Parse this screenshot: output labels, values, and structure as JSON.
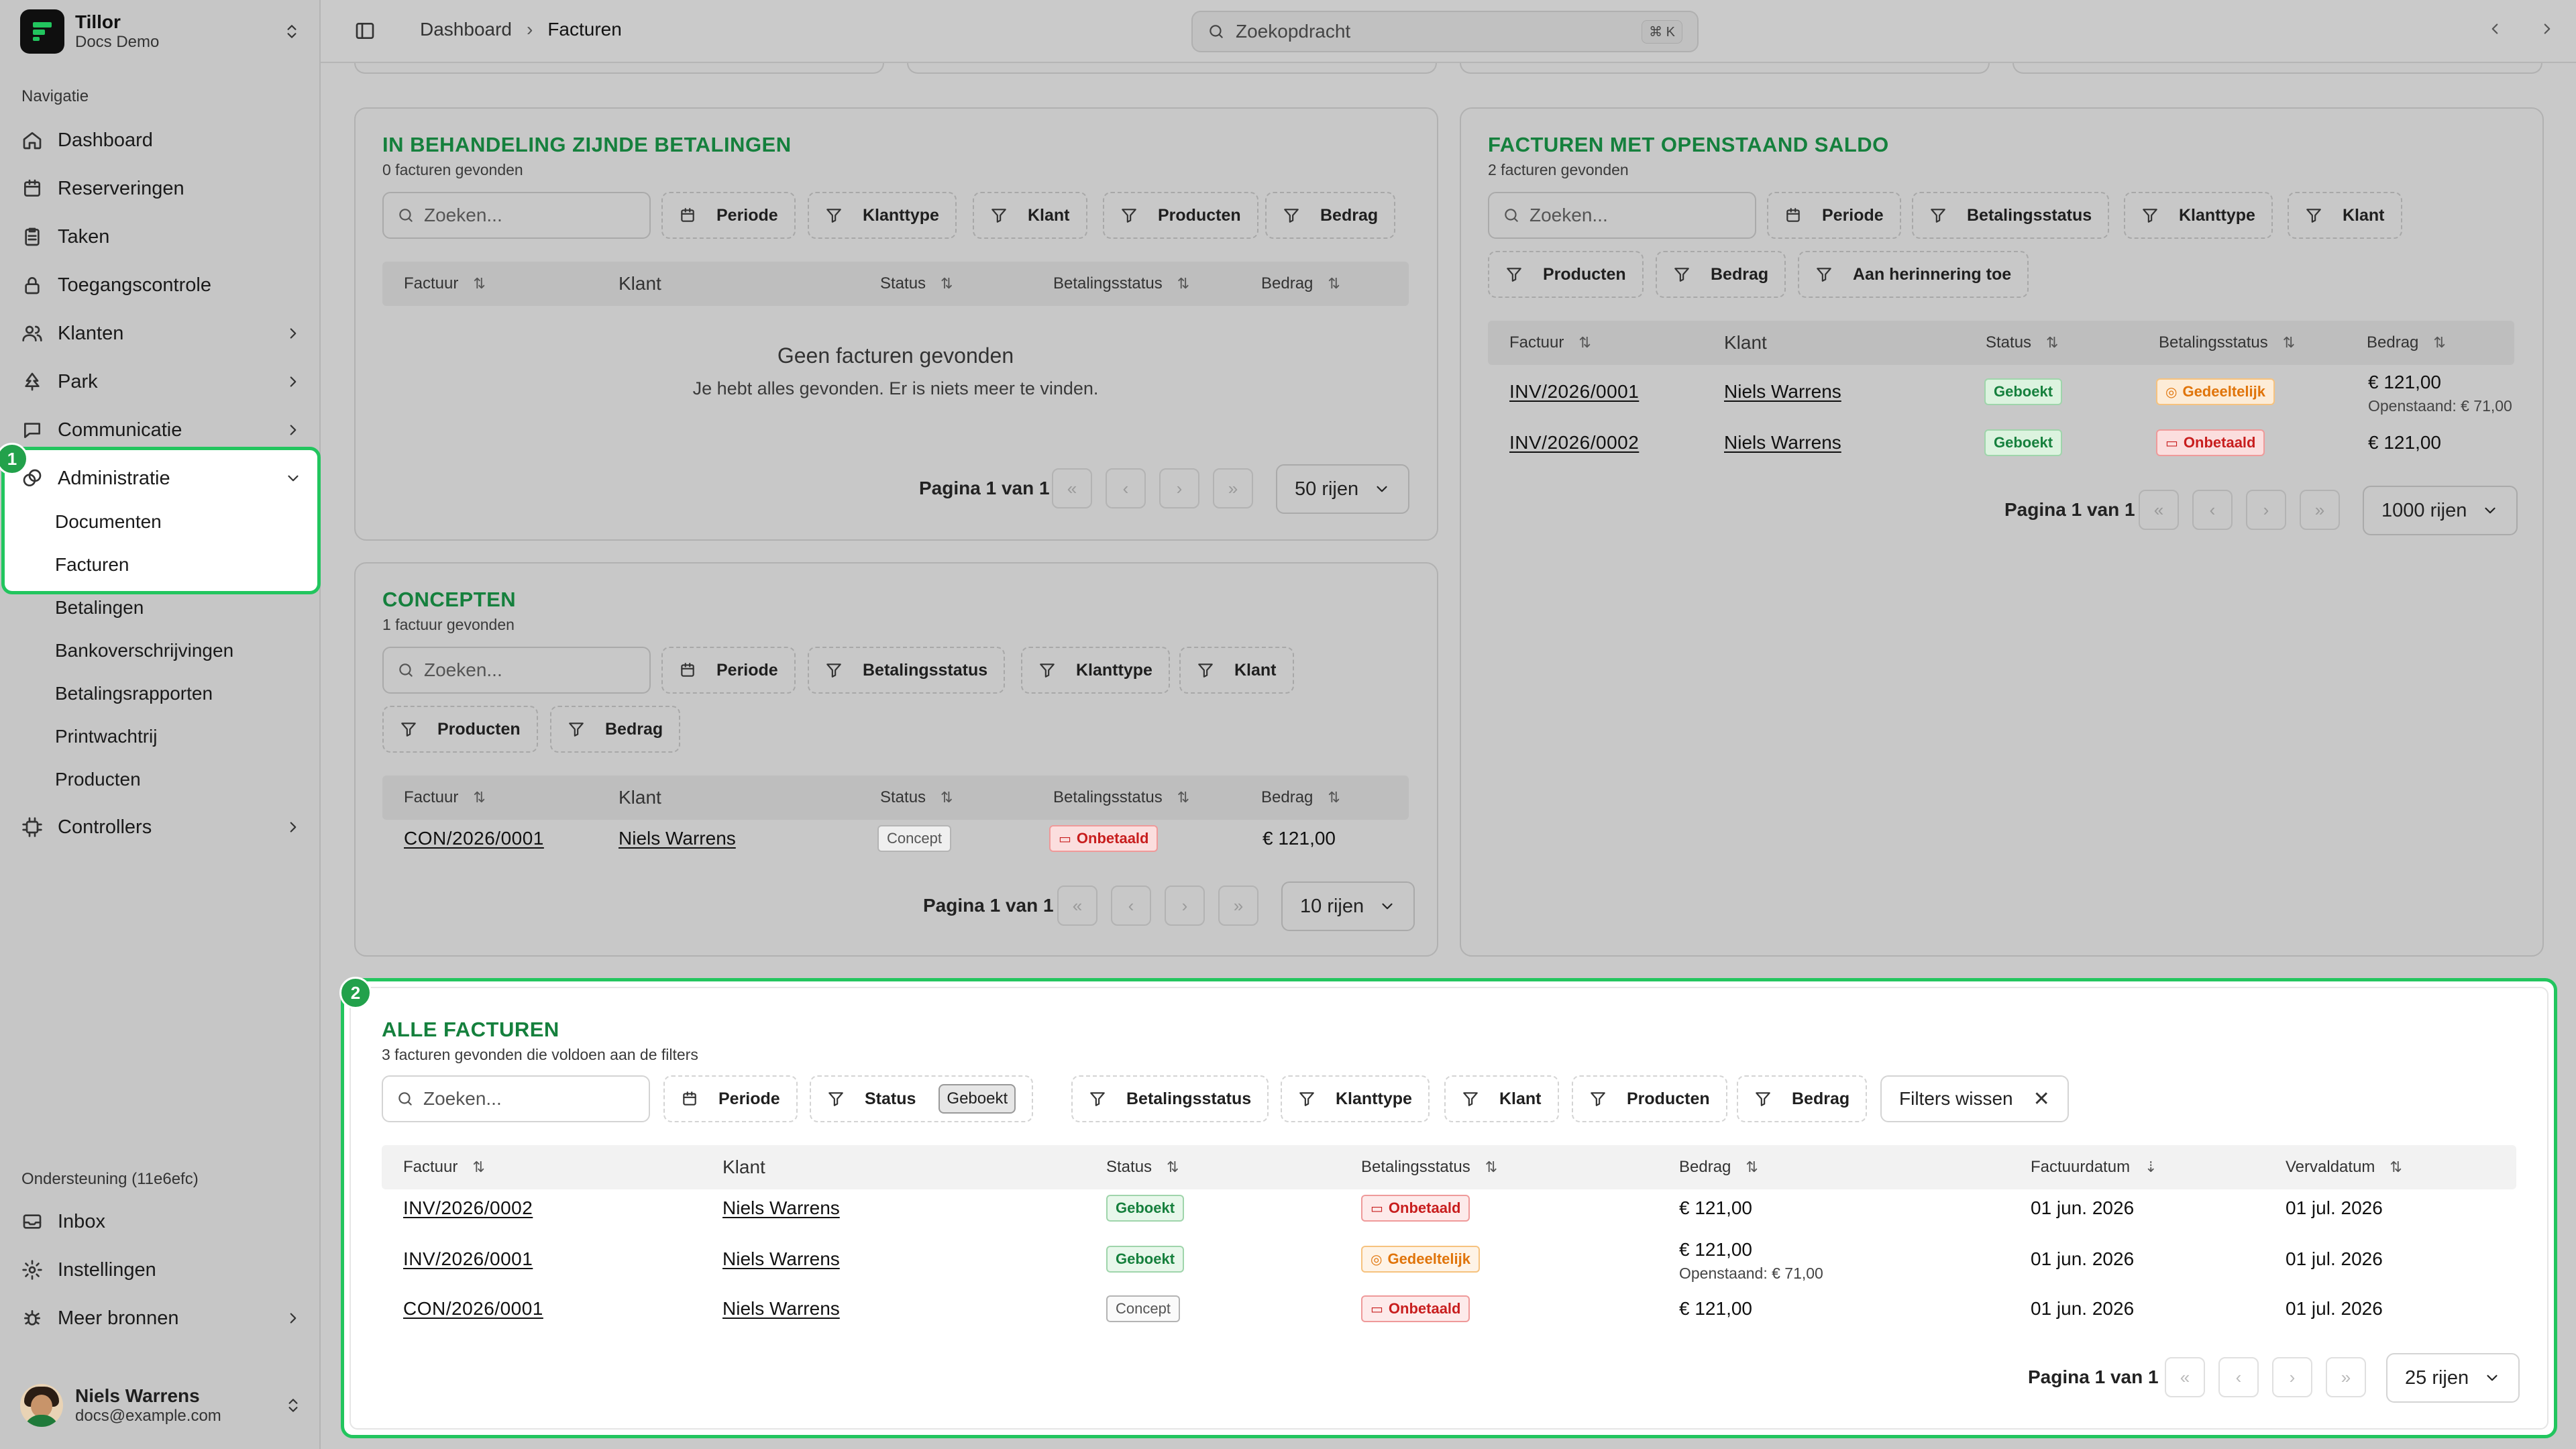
{
  "workspace": {
    "name": "Tillor",
    "sub": "Docs Demo"
  },
  "nav": {
    "section": "Navigatie",
    "items": [
      "Dashboard",
      "Reserveringen",
      "Taken",
      "Toegangscontrole",
      "Klanten",
      "Park",
      "Communicatie",
      "Administratie"
    ],
    "admin_sub": [
      "Documenten",
      "Facturen",
      "Betalingen",
      "Bankoverschrijvingen",
      "Betalingsrapporten",
      "Printwachtrij",
      "Producten"
    ],
    "controllers": "Controllers",
    "support_section": "Ondersteuning (11e6efc)",
    "support": [
      "Inbox",
      "Instellingen",
      "Meer bronnen"
    ]
  },
  "user": {
    "name": "Niels Warrens",
    "email": "docs@example.com"
  },
  "header": {
    "crumb1": "Dashboard",
    "crumb2": "Facturen",
    "search_placeholder": "Zoekopdracht",
    "shortcut": "⌘ K"
  },
  "badges": [
    "1",
    "2"
  ],
  "common": {
    "search": "Zoeken...",
    "page": "Pagina 1 van 1",
    "col_factuur": "Factuur",
    "col_klant": "Klant",
    "col_status": "Status",
    "col_betaal": "Betalingsstatus",
    "col_bedrag": "Bedrag",
    "col_fdatum": "Factuurdatum",
    "col_vdatum": "Vervaldatum"
  },
  "filters": {
    "periode": "Periode",
    "klanttype": "Klanttype",
    "klant": "Klant",
    "producten": "Producten",
    "bedrag": "Bedrag",
    "betalingsstatus": "Betalingsstatus",
    "herinnering": "Aan herinnering toe",
    "status": "Status",
    "status_chip": "Geboekt",
    "clear": "Filters wissen"
  },
  "pending": {
    "title": "IN BEHANDELING ZIJNDE BETALINGEN",
    "subtitle": "0 facturen gevonden",
    "empty_title": "Geen facturen gevonden",
    "empty_text": "Je hebt alles gevonden. Er is niets meer te vinden.",
    "rows": "50 rijen"
  },
  "open": {
    "title": "FACTUREN MET OPENSTAAND SALDO",
    "subtitle": "2 facturen gevonden",
    "rows_sel": "1000 rijen",
    "rows": [
      {
        "factuur": "INV/2026/0001",
        "klant": "Niels Warrens",
        "status": "Geboekt",
        "betaal": "Gedeeltelijk",
        "bedrag": "€ 121,00",
        "open": "Openstaand: € 71,00"
      },
      {
        "factuur": "INV/2026/0002",
        "klant": "Niels Warrens",
        "status": "Geboekt",
        "betaal": "Onbetaald",
        "bedrag": "€ 121,00"
      }
    ]
  },
  "concepts": {
    "title": "CONCEPTEN",
    "subtitle": "1 factuur gevonden",
    "rows_sel": "10 rijen",
    "rows": [
      {
        "factuur": "CON/2026/0001",
        "klant": "Niels Warrens",
        "status": "Concept",
        "betaal": "Onbetaald",
        "bedrag": "€ 121,00"
      }
    ]
  },
  "all": {
    "title": "ALLE FACTUREN",
    "subtitle": "3 facturen gevonden die voldoen aan de filters",
    "rows_sel": "25 rijen",
    "rows": [
      {
        "factuur": "INV/2026/0002",
        "klant": "Niels Warrens",
        "status": "Geboekt",
        "betaal": "Onbetaald",
        "bedrag": "€ 121,00",
        "fdatum": "01 jun. 2026",
        "vdatum": "01 jul. 2026"
      },
      {
        "factuur": "INV/2026/0001",
        "klant": "Niels Warrens",
        "status": "Geboekt",
        "betaal": "Gedeeltelijk",
        "bedrag": "€ 121,00",
        "open": "Openstaand: € 71,00",
        "fdatum": "01 jun. 2026",
        "vdatum": "01 jul. 2026"
      },
      {
        "factuur": "CON/2026/0001",
        "klant": "Niels Warrens",
        "status": "Concept",
        "betaal": "Onbetaald",
        "bedrag": "€ 121,00",
        "fdatum": "01 jun. 2026",
        "vdatum": "01 jul. 2026"
      }
    ]
  },
  "colors": {
    "accent": "#15803d",
    "highlight": "#22c55e",
    "unpaid": "#c81e1e",
    "partial": "#e0740a"
  }
}
